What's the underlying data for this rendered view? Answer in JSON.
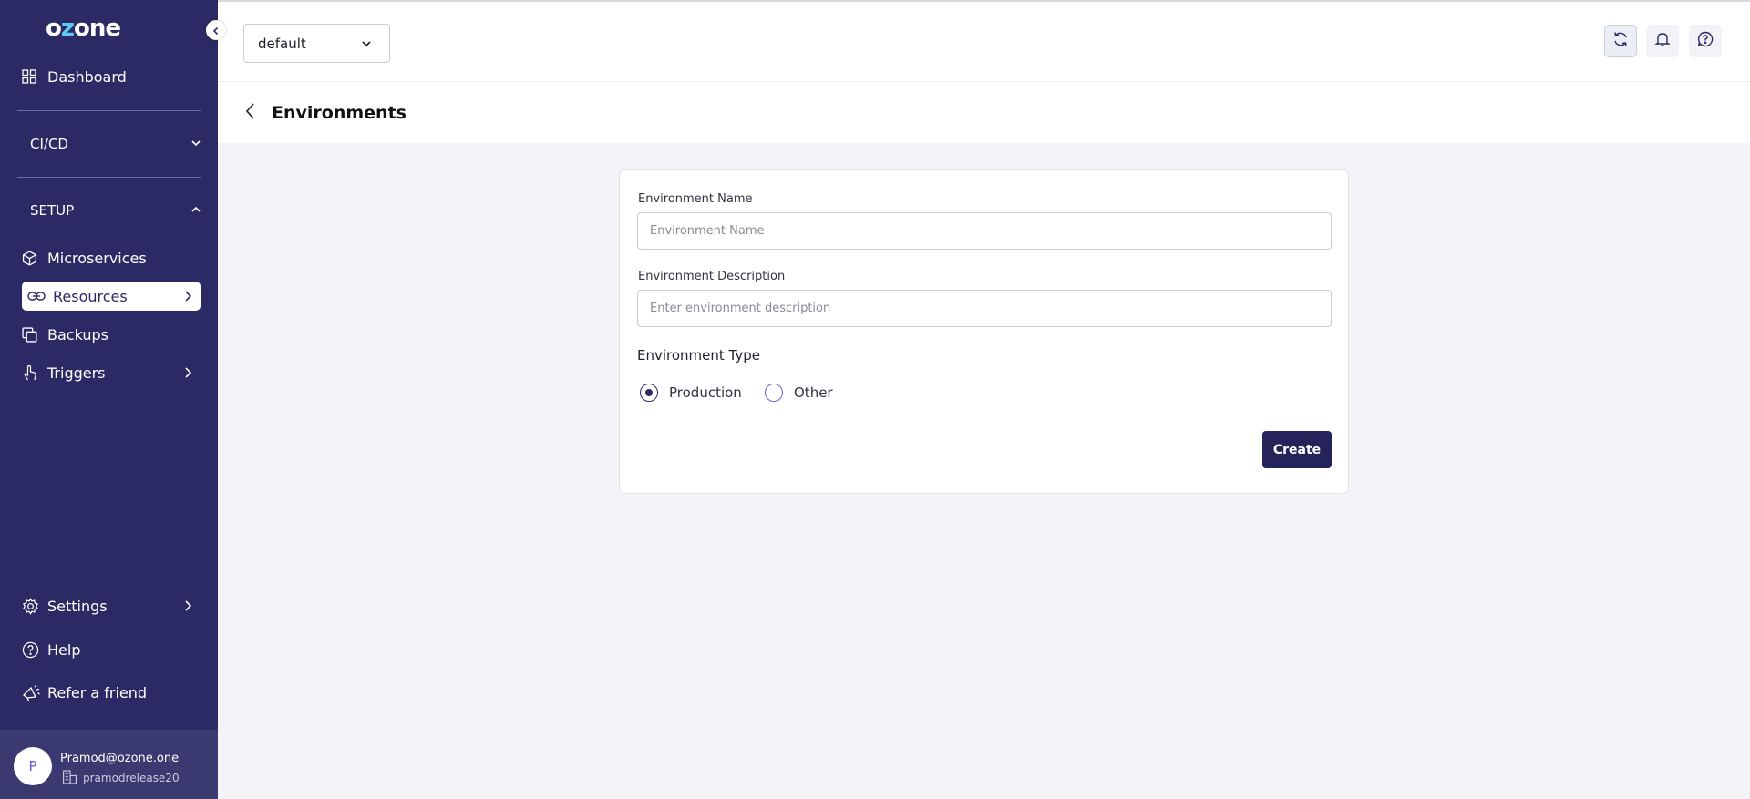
{
  "brand": {
    "logo_prefix": "o",
    "logo_accent": "z",
    "logo_suffix": "one"
  },
  "sidebar": {
    "dashboard": "Dashboard",
    "cicd": "CI/CD",
    "setup": "SETUP",
    "microservices": "Microservices",
    "resources": "Resources",
    "backups": "Backups",
    "triggers": "Triggers",
    "settings": "Settings",
    "help": "Help",
    "refer": "Refer a friend"
  },
  "user": {
    "initial": "P",
    "email": "Pramod@ozone.one",
    "org": "pramodrelease20"
  },
  "topbar": {
    "namespace": "default"
  },
  "page": {
    "title": "Environments"
  },
  "form": {
    "name_label": "Environment Name",
    "name_placeholder": "Environment Name",
    "name_value": "",
    "description_label": "Environment Description",
    "description_placeholder": "Enter environment description",
    "description_value": "",
    "type_label": "Environment Type",
    "type_options": [
      "Production",
      "Other"
    ],
    "type_selected": "Production",
    "create_label": "Create"
  },
  "colors": {
    "sidebar_bg": "#2b2a64",
    "accent": "#24235a",
    "logo_accent": "#5fc9f3",
    "page_bg": "#f4f4f8"
  },
  "icons": {
    "dashboard": "grid-icon",
    "microservices": "cube-icon",
    "resources": "link-icon",
    "backups": "copy-icon",
    "triggers": "hand-pointer-icon",
    "settings": "gear-icon",
    "help": "help-circle-icon",
    "refer": "megaphone-icon",
    "refresh": "refresh-icon",
    "notifications": "bell-icon",
    "support": "question-chat-icon"
  }
}
